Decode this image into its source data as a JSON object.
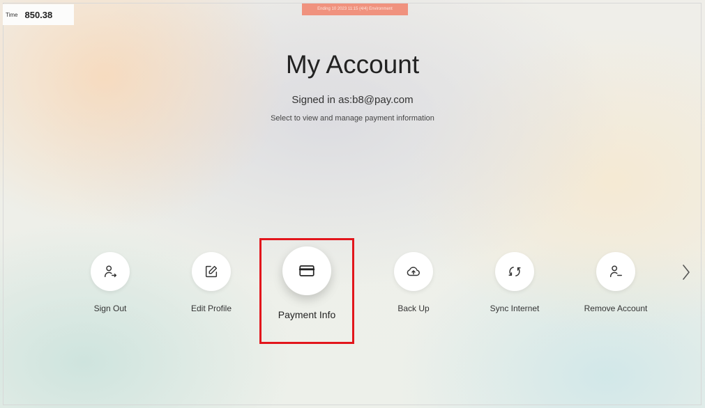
{
  "timer": {
    "label": "Time",
    "value": "850.38"
  },
  "banner": {
    "text": "Ending 10 2023 11:15 (4/4) Environment"
  },
  "page": {
    "title": "My Account",
    "signed_in": "Signed in as:b8@pay.com",
    "instructions": "Select to view and manage payment information"
  },
  "menu": {
    "items": [
      {
        "label": "Sign Out",
        "icon": "person-arrow-icon"
      },
      {
        "label": "Edit Profile",
        "icon": "edit-icon"
      },
      {
        "label": "Payment Info",
        "icon": "credit-card-icon",
        "focused": true
      },
      {
        "label": "Back Up",
        "icon": "cloud-upload-icon"
      },
      {
        "label": "Sync Internet",
        "icon": "sync-icon"
      },
      {
        "label": "Remove Account",
        "icon": "person-minus-icon"
      }
    ],
    "next_icon": "chevron-right-icon"
  },
  "colors": {
    "focus_outline": "#e2161c",
    "banner_bg": "#f0927e"
  }
}
